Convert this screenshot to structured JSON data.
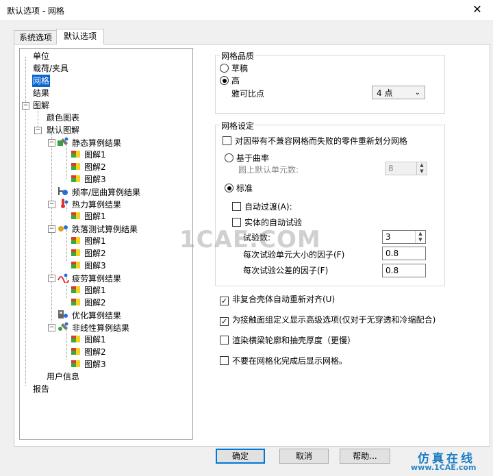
{
  "window": {
    "title": "默认选项 - 网格",
    "close_glyph": "✕"
  },
  "tabs": [
    {
      "label": "系统选项",
      "active": false
    },
    {
      "label": "默认选项",
      "active": true
    }
  ],
  "tree": {
    "items": [
      {
        "label": "单位",
        "selected": false
      },
      {
        "label": "载荷/夹具",
        "selected": false
      },
      {
        "label": "网格",
        "selected": true
      },
      {
        "label": "结果",
        "selected": false
      },
      {
        "label": "图解",
        "selected": false,
        "expanded": true
      },
      {
        "label": "颜色图表"
      },
      {
        "label": "默认图解",
        "expanded": true
      },
      {
        "label": "静态算例结果",
        "icon": "static-study-icon"
      },
      {
        "label": "图解1",
        "icon": "plot-icon"
      },
      {
        "label": "图解2",
        "icon": "plot-icon"
      },
      {
        "label": "图解3",
        "icon": "plot-icon"
      },
      {
        "label": "频率/屈曲算例结果",
        "icon": "frequency-study-icon"
      },
      {
        "label": "热力算例结果",
        "icon": "thermal-study-icon"
      },
      {
        "label": "图解1",
        "icon": "plot-icon"
      },
      {
        "label": "跌落测试算例结果",
        "icon": "drop-test-study-icon"
      },
      {
        "label": "图解1",
        "icon": "plot-icon"
      },
      {
        "label": "图解2",
        "icon": "plot-icon"
      },
      {
        "label": "图解3",
        "icon": "plot-icon"
      },
      {
        "label": "疲劳算例结果",
        "icon": "fatigue-study-icon"
      },
      {
        "label": "图解1",
        "icon": "plot-icon"
      },
      {
        "label": "图解2",
        "icon": "plot-icon"
      },
      {
        "label": "优化算例结果",
        "icon": "optimization-study-icon"
      },
      {
        "label": "非线性算例结果",
        "icon": "nonlinear-study-icon"
      },
      {
        "label": "图解1",
        "icon": "plot-icon"
      },
      {
        "label": "图解2",
        "icon": "plot-icon"
      },
      {
        "label": "图解3",
        "icon": "plot-icon"
      },
      {
        "label": "用户信息"
      },
      {
        "label": "报告"
      }
    ]
  },
  "mesh_quality": {
    "legend": "网格品质",
    "draft_label": "草稿",
    "high_label": "高",
    "jacobian_label": "雅可比点",
    "jacobian_value": "4 点"
  },
  "mesh_settings": {
    "legend": "网格设定",
    "remesh_label": "对因带有不兼容网格而失败的零件重新划分网格",
    "curvature_label": "基于曲率",
    "min_elements_label": "圆上默认单元数:",
    "min_elements_value": "8",
    "standard_label": "标准",
    "auto_transition_label": "自动过渡(A):",
    "auto_trials_label": "实体的自动试验",
    "trials_count_label": "试验数:",
    "trials_count_value": "3",
    "element_size_factor_label": "每次试验单元大小的因子(F)",
    "element_size_factor_value": "0.8",
    "tolerance_factor_label": "每次试验公差的因子(F)",
    "tolerance_factor_value": "0.8"
  },
  "options": {
    "realign_label": "非复合壳体自动重新对齐(U)",
    "contact_advanced_label": "为接触面组定义显示高级选项(仅对于无穿透和冷缩配合)",
    "render_beam_label": "渲染横梁轮廓和抽壳厚度（更慢）",
    "dont_show_mesh_label": "不要在网格化完成后显示网格。"
  },
  "buttons": {
    "ok": "确定",
    "cancel": "取消",
    "help": "帮助..."
  },
  "watermark": {
    "text": "1CAE.COM",
    "brand": "仿真在线",
    "brand_url": "www.1CAE.com"
  },
  "check_glyph": "✓"
}
